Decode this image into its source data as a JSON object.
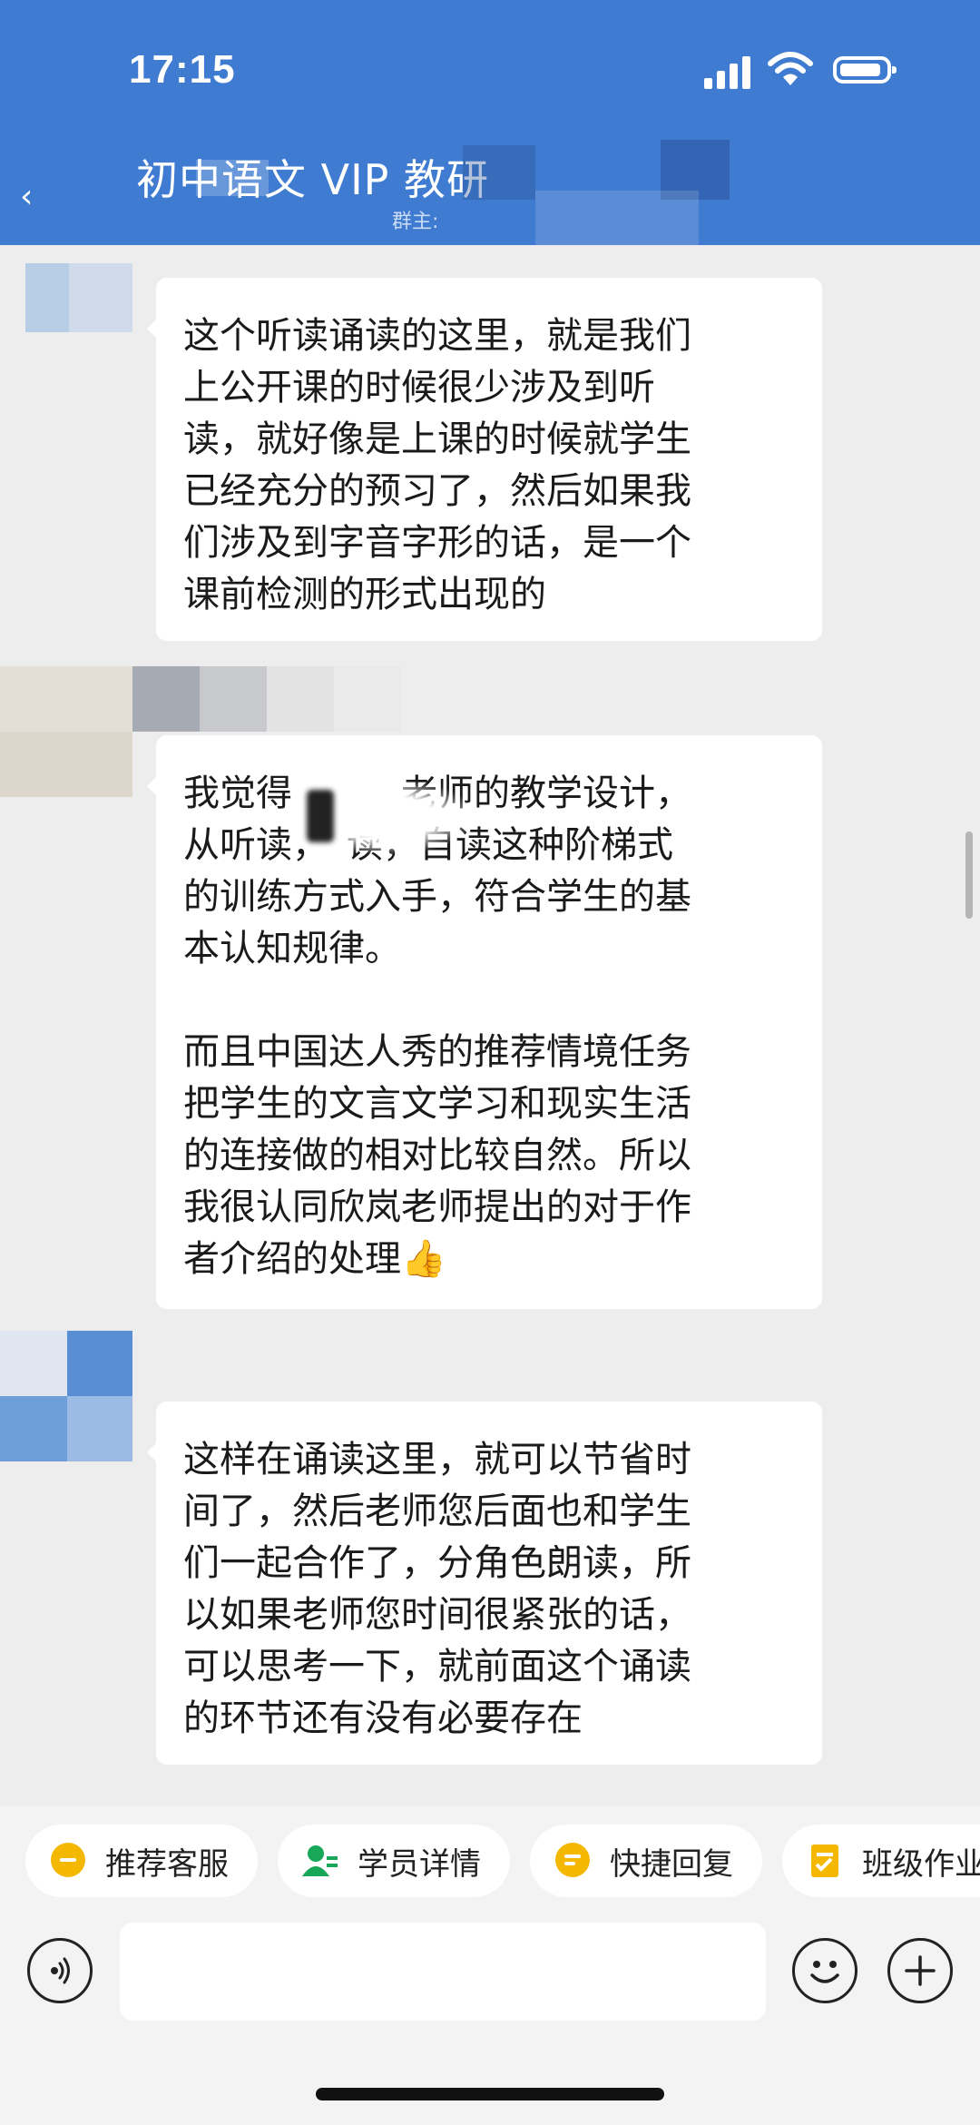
{
  "status_bar": {
    "time": "17:15"
  },
  "header": {
    "back_glyph": "‹",
    "title": "初中语文 VIP 教研",
    "subtitle": "群主:"
  },
  "messages": [
    {
      "text": "这个听读诵读的这里，就是我们\n上公开课的时候很少涉及到听\n读，就好像是上课的时候就学生\n已经充分的预习了，然后如果我\n们涉及到字音字形的话，是一个\n课前检测的形式出现的"
    },
    {
      "text": "我觉得　　　老师的教学设计，\n从听读，　读，自读这种阶梯式\n的训练方式入手，符合学生的基\n本认知规律。\n\n而且中国达人秀的推荐情境任务\n把学生的文言文学习和现实生活\n的连接做的相对比较自然。所以\n我很认同欣岚老师提出的对于作\n者介绍的处理👍"
    },
    {
      "text": "这样在诵读这里，就可以节省时\n间了，然后老师您后面也和学生\n们一起合作了，分角色朗读，所\n以如果老师您时间很紧张的话，\n可以思考一下，就前面这个诵读\n的环节还有没有必要存在"
    }
  ],
  "quick_actions": [
    {
      "label": "推荐客服",
      "icon": "chat-bubble-icon"
    },
    {
      "label": "学员详情",
      "icon": "user-detail-icon"
    },
    {
      "label": "快捷回复",
      "icon": "quick-reply-icon"
    },
    {
      "label": "班级作业",
      "icon": "homework-icon"
    }
  ],
  "input": {
    "placeholder": ""
  },
  "colors": {
    "header": "#3f7bd0",
    "background": "#ededed",
    "bubble": "#ffffff",
    "chip_icon_yellow": "#f5b800",
    "chip_icon_green": "#19a85a"
  }
}
